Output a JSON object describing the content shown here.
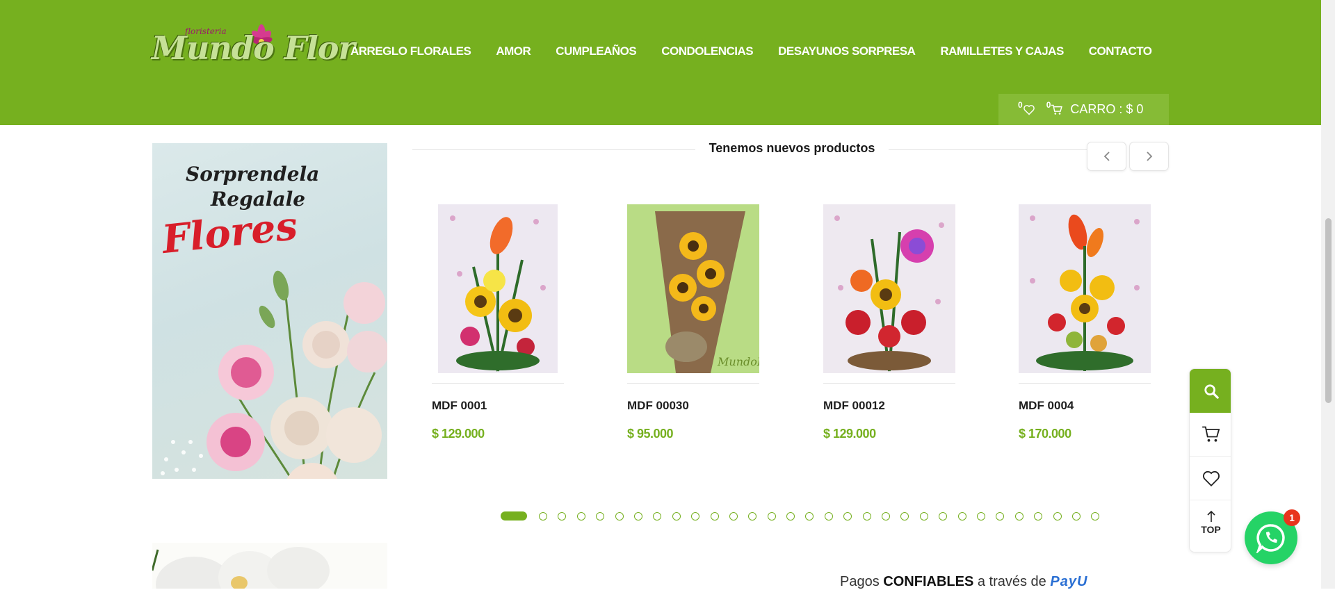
{
  "logo": {
    "small": "floristeria",
    "main": "Mundo Flor"
  },
  "nav": {
    "items": [
      {
        "label": "ARREGLO FLORALES"
      },
      {
        "label": "AMOR"
      },
      {
        "label": "CUMPLEAÑOS"
      },
      {
        "label": "CONDOLENCIAS"
      },
      {
        "label": "DESAYUNOS SORPRESA"
      },
      {
        "label": "RAMILLETES Y CAJAS"
      },
      {
        "label": "CONTACTO"
      }
    ]
  },
  "cart_bar": {
    "wishlist_count": "0",
    "cart_count": "0",
    "cart_label": "CARRO : $ 0"
  },
  "banner": {
    "line1": "Sorprendela",
    "line2": "Regalale",
    "line3": "Flores"
  },
  "products_section": {
    "title": "Tenemos nuevos productos",
    "prev_icon": "chevron-left-icon",
    "next_icon": "chevron-right-icon",
    "items": [
      {
        "name": "MDF 0001",
        "price": "$ 129.000"
      },
      {
        "name": "MDF 00030",
        "price": "$ 95.000"
      },
      {
        "name": "MDF 00012",
        "price": "$ 129.000"
      },
      {
        "name": "MDF 0004",
        "price": "$ 170.000"
      }
    ],
    "pagination": {
      "total": 31,
      "active": 1
    }
  },
  "sidebar": {
    "top_label": "TOP"
  },
  "whatsapp": {
    "badge": "1"
  },
  "payments": {
    "prefix": "Pagos",
    "bold": "CONFIABLES",
    "middle": "a través de",
    "brand": "PayU"
  },
  "colors": {
    "brand_green": "#76b01f",
    "whatsapp_green": "#25d366",
    "price_green": "#76b01f"
  }
}
